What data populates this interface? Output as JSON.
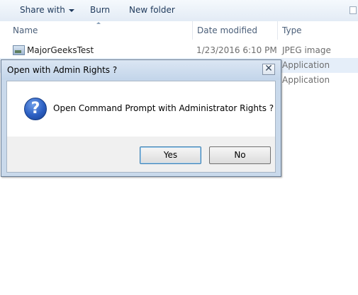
{
  "toolbar": {
    "share_with": "Share with",
    "burn": "Burn",
    "new_folder": "New folder"
  },
  "columns": {
    "name": "Name",
    "date_modified": "Date modified",
    "type": "Type"
  },
  "files": [
    {
      "name": "MajorGeeksTest",
      "date": "1/23/2016 6:10 PM",
      "type": "JPEG image"
    },
    {
      "name": "",
      "date": "",
      "type": "Application"
    },
    {
      "name": "",
      "date": "",
      "type": "Application"
    }
  ],
  "dialog": {
    "title": "Open with Admin Rights ?",
    "close_glyph": "✕",
    "message": "Open Command Prompt with Administrator Rights ?",
    "icon_glyph": "?",
    "yes_label": "Yes",
    "no_label": "No"
  }
}
